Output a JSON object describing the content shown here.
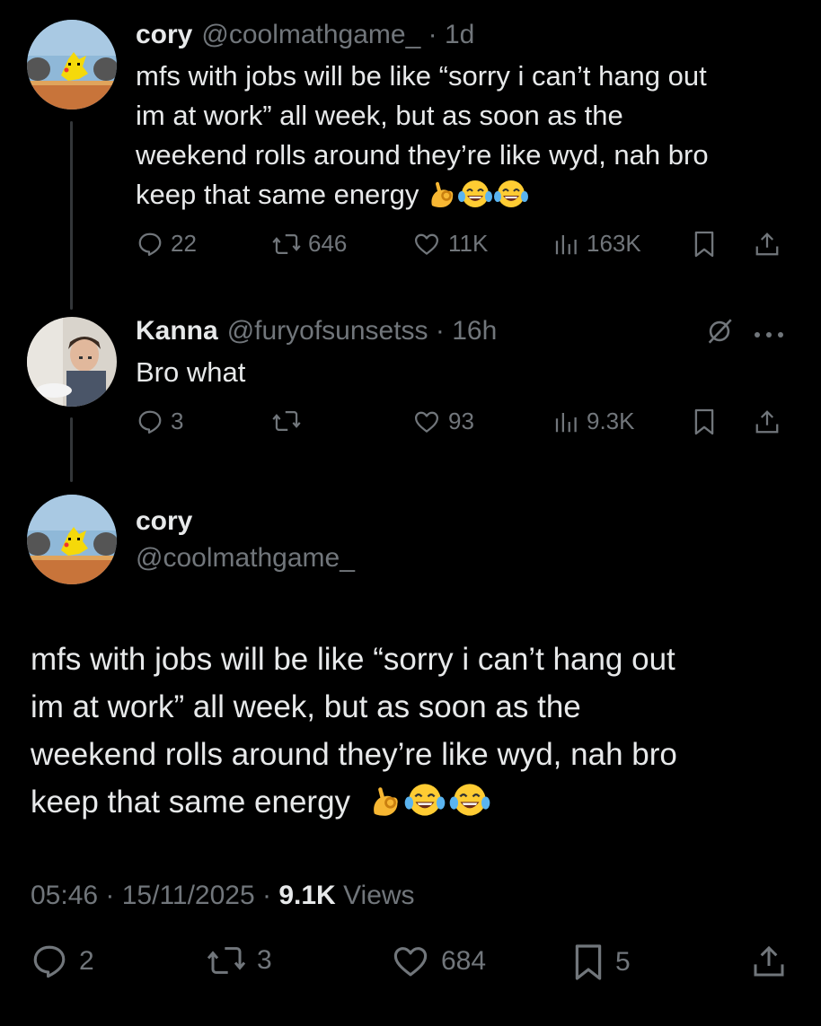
{
  "tweets": [
    {
      "author": {
        "name": "cory",
        "handle": "@coolmathgame_",
        "time": "1d"
      },
      "text_lines": [
        "mfs with jobs will be like “sorry i can’t hang out",
        "im at work” all week, but as soon as the",
        "weekend rolls around they’re like wyd, nah bro",
        "keep that same energy"
      ],
      "emojis": [
        "ok-hand",
        "tears-of-joy",
        "tears-of-joy"
      ],
      "stats": {
        "replies": "22",
        "reposts": "646",
        "likes": "11K",
        "views": "163K"
      }
    },
    {
      "author": {
        "name": "Kanna",
        "handle": "@furyofsunsetss",
        "time": "16h"
      },
      "text_lines": [
        "Bro what"
      ],
      "stats": {
        "replies": "3",
        "reposts": "",
        "likes": "93",
        "views": "9.3K"
      }
    }
  ],
  "main_post": {
    "author": {
      "name": "cory",
      "handle": "@coolmathgame_"
    },
    "text_lines": [
      "mfs with jobs will be like “sorry i can’t hang out",
      "im at work” all week, but as soon as the",
      "weekend rolls around they’re like wyd, nah bro",
      "keep that same energy"
    ],
    "emojis": [
      "ok-hand",
      "tears-of-joy",
      "tears-of-joy"
    ],
    "time": "05:46",
    "date": "15/11/2025",
    "views_count": "9.1K",
    "views_label": "Views",
    "stats": {
      "replies": "2",
      "reposts": "3",
      "likes": "684",
      "bookmarks": "5"
    }
  },
  "colors": {
    "background": "#000000",
    "text": "#e7e9ea",
    "muted": "#71767b",
    "thread_line": "#333639"
  }
}
